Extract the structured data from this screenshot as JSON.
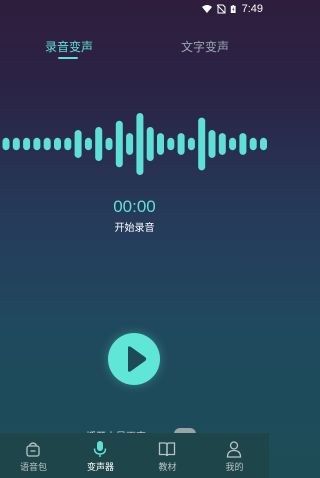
{
  "status_bar": {
    "time": "7:49",
    "icons": [
      "wifi-icon",
      "no-sim-icon",
      "battery-charging-icon"
    ]
  },
  "tabs": [
    {
      "label": "录音变声",
      "active": true
    },
    {
      "label": "文字变声",
      "active": false
    }
  ],
  "waveform_levels": [
    0.2,
    0.2,
    0.2,
    0.2,
    0.2,
    0.2,
    0.2,
    0.45,
    0.2,
    0.55,
    0.2,
    0.75,
    0.35,
    1.0,
    0.55,
    0.35,
    0.2,
    0.35,
    0.2,
    0.85,
    0.45,
    0.35,
    0.2,
    0.35,
    0.2,
    0.2,
    0.2
  ],
  "recorder": {
    "timer": "00:00",
    "hint": "开始录音",
    "toggle_label": "播开本是更声",
    "toggle_on": false
  },
  "bottom_nav": [
    {
      "label": "语音包",
      "icon": "voice-pack-icon",
      "active": false
    },
    {
      "label": "变声器",
      "icon": "microphone-icon",
      "active": true
    },
    {
      "label": "教材",
      "icon": "book-icon",
      "active": false
    },
    {
      "label": "我的",
      "icon": "profile-icon",
      "active": false
    }
  ],
  "colors": {
    "accent": "#5fe0d6",
    "nav_bg": "#1e454a",
    "inactive_text": "#9aa6b4"
  }
}
